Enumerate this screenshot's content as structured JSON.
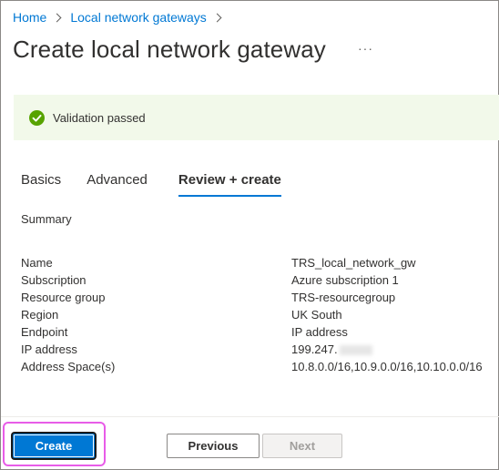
{
  "breadcrumb": {
    "items": [
      "Home",
      "Local network gateways"
    ]
  },
  "page": {
    "title": "Create local network gateway",
    "more_label": "···"
  },
  "validation": {
    "text": "Validation passed",
    "icon": "check-circle-icon",
    "color": "#57a300"
  },
  "tabs": [
    "Basics",
    "Advanced",
    "Review + create"
  ],
  "active_tab": "Review + create",
  "summary": {
    "heading": "Summary",
    "rows": [
      {
        "label": "Name",
        "value": "TRS_local_network_gw"
      },
      {
        "label": "Subscription",
        "value": "Azure subscription 1"
      },
      {
        "label": "Resource group",
        "value": "TRS-resourcegroup"
      },
      {
        "label": "Region",
        "value": "UK South"
      },
      {
        "label": "Endpoint",
        "value": "IP address"
      },
      {
        "label": "IP address",
        "value": "199.247."
      },
      {
        "label": "Address Space(s)",
        "value": "10.8.0.0/16,10.9.0.0/16,10.10.0.0/16"
      }
    ]
  },
  "footer": {
    "create_label": "Create",
    "previous_label": "Previous",
    "next_label": "Next"
  },
  "colors": {
    "accent": "#0078d4",
    "highlight": "#e85ce8",
    "banner_bg": "#f2f9ea"
  }
}
